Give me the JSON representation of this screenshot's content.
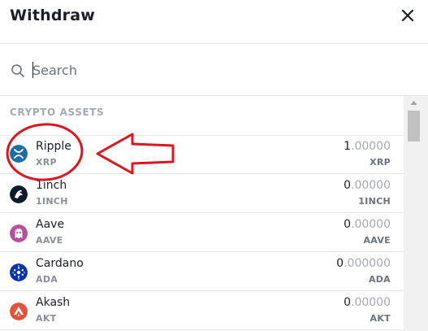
{
  "header": {
    "title": "Withdraw",
    "close_icon": "close-icon"
  },
  "search": {
    "placeholder": "Search",
    "icon": "search-icon"
  },
  "section_label": "CRYPTO ASSETS",
  "assets": [
    {
      "name": "Ripple",
      "symbol": "XRP",
      "amount_lead": "1",
      "amount_zeros": ".00000",
      "color": "#1c6ea4",
      "icon": "ripple-icon"
    },
    {
      "name": "1inch",
      "symbol": "1INCH",
      "amount_lead": "0",
      "amount_zeros": ".00000",
      "color": "#0d1a2b",
      "icon": "1inch-icon"
    },
    {
      "name": "Aave",
      "symbol": "AAVE",
      "amount_lead": "0",
      "amount_zeros": ".00000",
      "color": "#b6509e",
      "icon": "aave-icon"
    },
    {
      "name": "Cardano",
      "symbol": "ADA",
      "amount_lead": "0",
      "amount_zeros": ".000000",
      "color": "#0033ad",
      "icon": "cardano-icon"
    },
    {
      "name": "Akash",
      "symbol": "AKT",
      "amount_lead": "0",
      "amount_zeros": ".00000",
      "color": "#e2533a",
      "icon": "akash-icon"
    }
  ],
  "annotation": {
    "color": "#e0141e"
  }
}
